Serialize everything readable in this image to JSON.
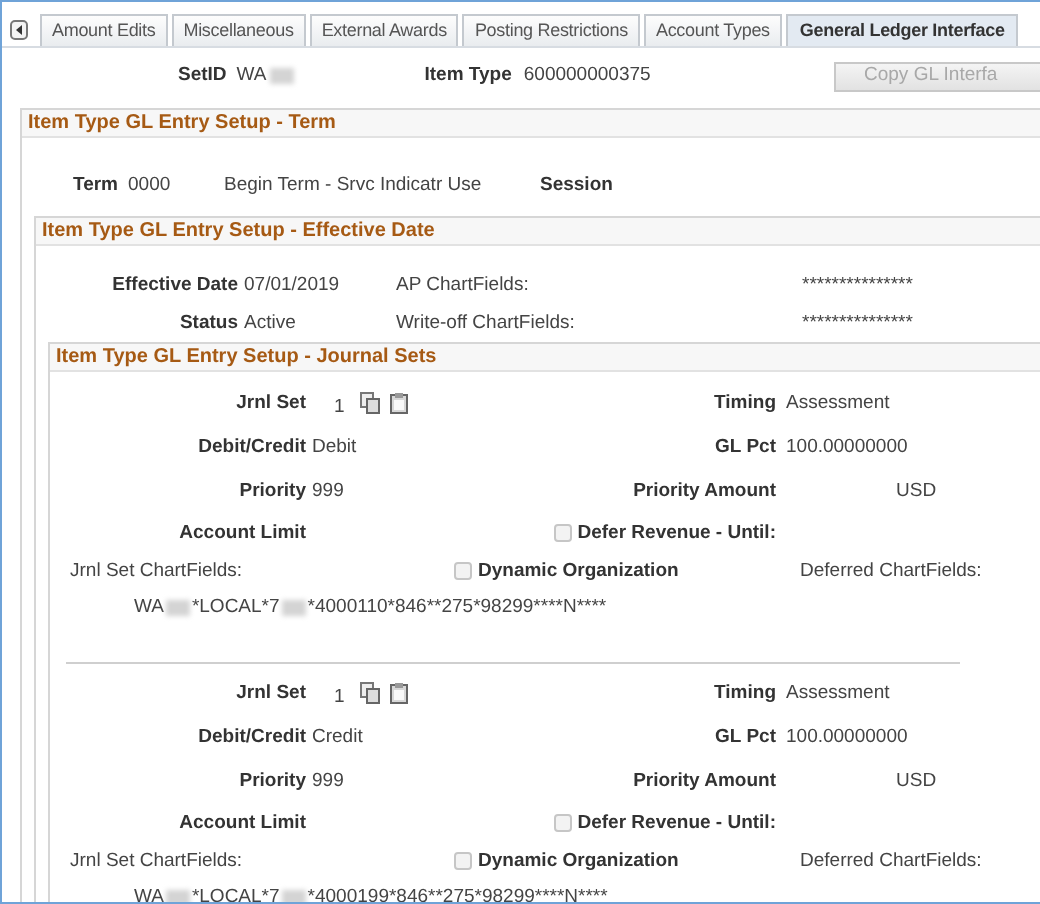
{
  "tabs": [
    {
      "label": "Amount Edits",
      "selected": false
    },
    {
      "label": "Miscellaneous",
      "selected": false
    },
    {
      "label": "External Awards",
      "selected": false
    },
    {
      "label": "Posting Restrictions",
      "selected": false
    },
    {
      "label": "Account Types",
      "selected": false
    },
    {
      "label": "General Ledger Interface",
      "selected": true
    }
  ],
  "setid": {
    "label": "SetID",
    "value": "WA",
    "redacted": true
  },
  "item_type": {
    "label": "Item Type",
    "value": "600000000375"
  },
  "copy_button": {
    "label": "Copy GL Interfa",
    "disabled": true
  },
  "term_section": {
    "title": "Item Type GL Entry Setup - Term",
    "term_label": "Term",
    "term_value": "0000",
    "term_description": "Begin Term - Srvc Indicatr Use",
    "session_label": "Session"
  },
  "effective_section": {
    "title": "Item Type GL Entry Setup - Effective Date",
    "rows": [
      {
        "label": "Effective Date",
        "value": "07/01/2019",
        "chartfield_label": "AP ChartFields:",
        "chartfield_value": "***************"
      },
      {
        "label": "Status",
        "value": "Active",
        "chartfield_label": "Write-off ChartFields:",
        "chartfield_value": "***************"
      }
    ]
  },
  "journal_section": {
    "title": "Item Type GL Entry Setup - Journal Sets",
    "sets": [
      {
        "jrnl_set": {
          "label": "Jrnl Set",
          "value": "1"
        },
        "timing": {
          "label": "Timing",
          "value": "Assessment"
        },
        "debit_credit": {
          "label": "Debit/Credit",
          "value": "Debit"
        },
        "gl_pct": {
          "label": "GL Pct",
          "value": "100.00000000"
        },
        "priority": {
          "label": "Priority",
          "value": "999"
        },
        "priority_amount": {
          "label": "Priority Amount",
          "currency": "USD"
        },
        "account_limit": {
          "label": "Account Limit"
        },
        "defer_revenue": {
          "label": "Defer Revenue - Until:",
          "checked": false
        },
        "jrnl_set_chartfields": {
          "label": "Jrnl Set ChartFields:",
          "segments": [
            "WA",
            "*LOCAL*7",
            "*4000110*846**275*98299****N****"
          ]
        },
        "dynamic_organization": {
          "label": "Dynamic Organization",
          "checked": false
        },
        "deferred_chartfields": {
          "label": "Deferred ChartFields:"
        }
      },
      {
        "jrnl_set": {
          "label": "Jrnl Set",
          "value": "1"
        },
        "timing": {
          "label": "Timing",
          "value": "Assessment"
        },
        "debit_credit": {
          "label": "Debit/Credit",
          "value": "Credit"
        },
        "gl_pct": {
          "label": "GL Pct",
          "value": "100.00000000"
        },
        "priority": {
          "label": "Priority",
          "value": "999"
        },
        "priority_amount": {
          "label": "Priority Amount",
          "currency": "USD"
        },
        "account_limit": {
          "label": "Account Limit"
        },
        "defer_revenue": {
          "label": "Defer Revenue - Until:",
          "checked": false
        },
        "jrnl_set_chartfields": {
          "label": "Jrnl Set ChartFields:",
          "segments": [
            "WA",
            "*LOCAL*7",
            "*4000199*846**275*98299****N****"
          ]
        },
        "dynamic_organization": {
          "label": "Dynamic Organization",
          "checked": false
        },
        "deferred_chartfields": {
          "label": "Deferred ChartFields:"
        }
      }
    ]
  }
}
